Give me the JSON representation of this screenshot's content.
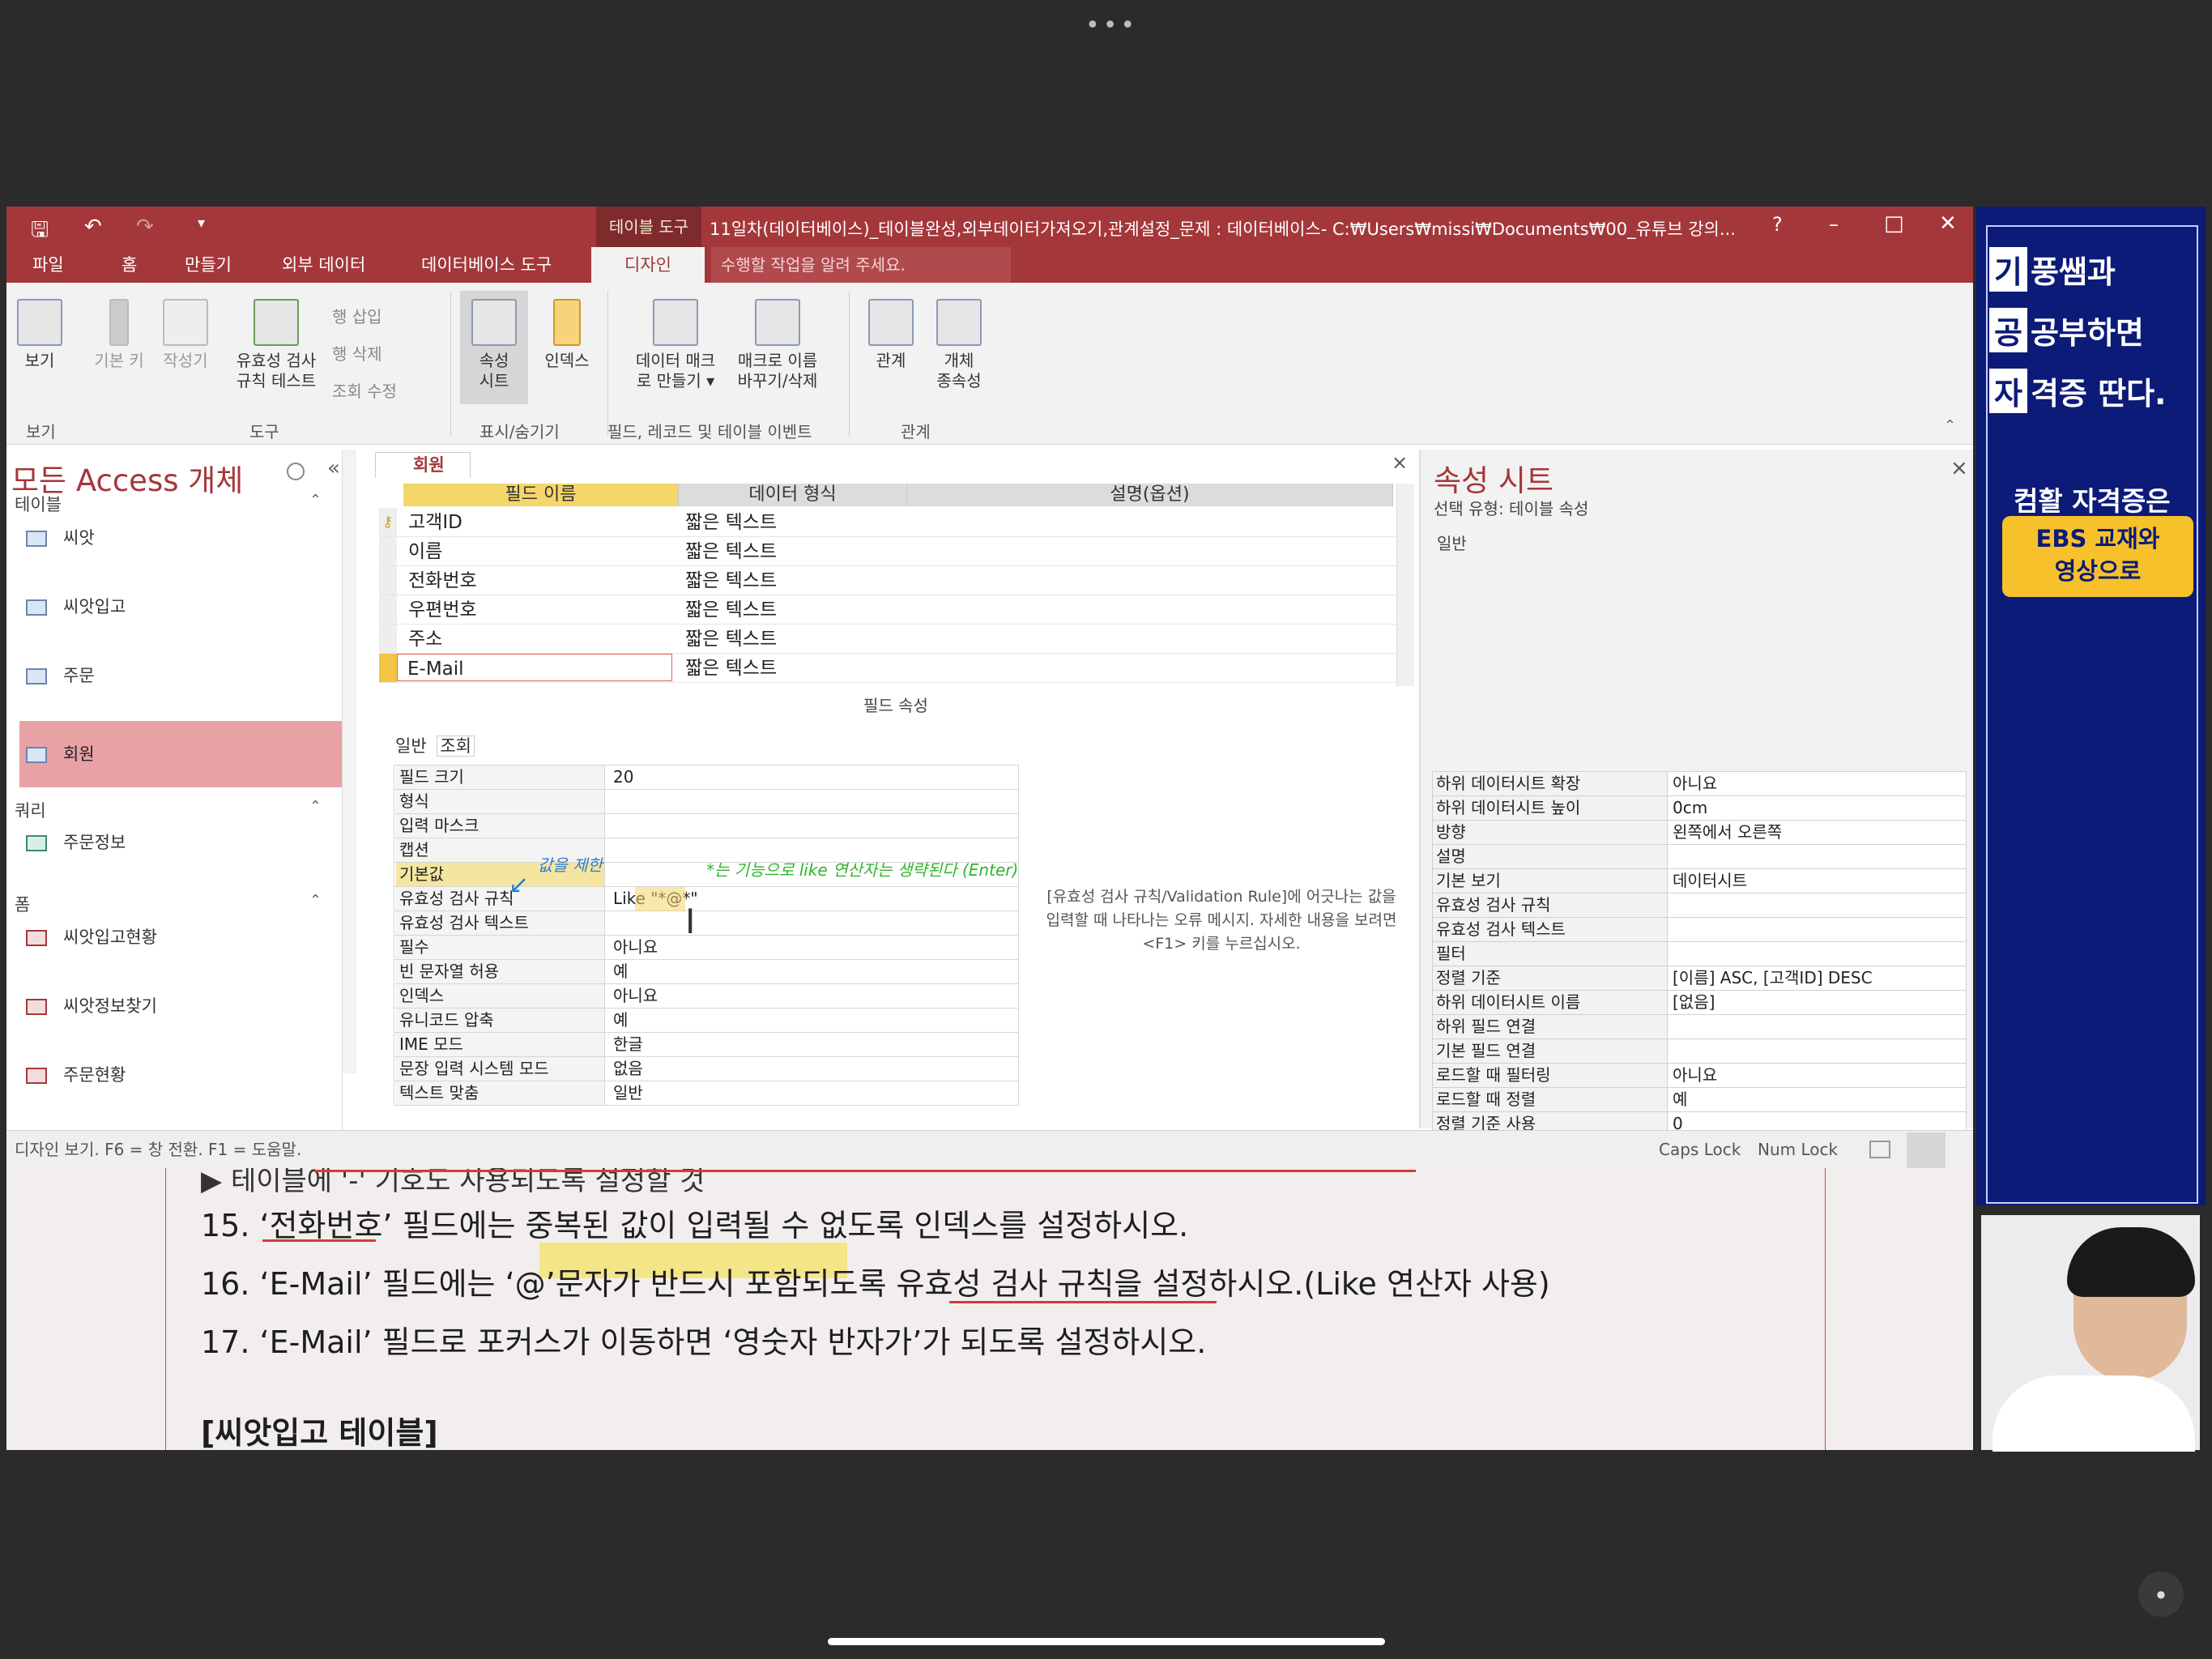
{
  "window": {
    "tool_tab": "테이블 도구",
    "title": "11일차(데이터베이스)_테이블완성,외부데이터가져오기,관계설정_문제 : 데이터베이스- C:₩Users₩missi₩Documents₩00_유튜브 강의...",
    "help": "?",
    "minimize": "–",
    "maximize": "□",
    "close": "✕"
  },
  "menu": [
    "파일",
    "홈",
    "만들기",
    "외부 데이터",
    "데이터베이스 도구"
  ],
  "menu_active": "디자인",
  "tellme": "수행할 작업을 알려 주세요.",
  "ribbon": {
    "view": "보기",
    "primary_key": "기본 키",
    "builder": "작성기",
    "validation1": "유효성 검사",
    "validation2": "규칙 테스트",
    "insert_row": "행 삽입",
    "delete_row": "행 삭제",
    "modify_lookup": "조회 수정",
    "prop_sheet1": "속성",
    "prop_sheet2": "시트",
    "index": "인덱스",
    "data_macro1": "데이터 매크",
    "data_macro2": "로 만들기 ▾",
    "rename_macro1": "매크로 이름",
    "rename_macro2": "바꾸기/삭제",
    "relations": "관계",
    "deps1": "개체",
    "deps2": "종속성",
    "groups": [
      "보기",
      "도구",
      "표시/숨기기",
      "필드, 레코드 및 테이블 이벤트",
      "관계"
    ]
  },
  "nav": {
    "title": "모든 Access 개체",
    "sections": [
      "테이블",
      "쿼리",
      "폼"
    ],
    "tables": [
      "씨앗",
      "씨앗입고",
      "주문",
      "회원"
    ],
    "queries": [
      "주문정보"
    ],
    "forms": [
      "씨앗입고현황",
      "씨앗정보찾기",
      "주문현황"
    ]
  },
  "doc_tab": "회원",
  "grid": {
    "headers": [
      "필드 이름",
      "데이터 형식",
      "설명(옵션)"
    ],
    "rows": [
      {
        "name": "고객ID",
        "type": "짧은 텍스트"
      },
      {
        "name": "이름",
        "type": "짧은 텍스트"
      },
      {
        "name": "전화번호",
        "type": "짧은 텍스트"
      },
      {
        "name": "우편번호",
        "type": "짧은 텍스트"
      },
      {
        "name": "주소",
        "type": "짧은 텍스트"
      },
      {
        "name": "E-Mail",
        "type": "짧은 텍스트"
      }
    ]
  },
  "field_props": {
    "title": "필드 속성",
    "tabs": [
      "일반",
      "조회"
    ],
    "rows": [
      {
        "label": "필드 크기",
        "value": "20"
      },
      {
        "label": "형식",
        "value": ""
      },
      {
        "label": "입력 마스크",
        "value": ""
      },
      {
        "label": "캡션",
        "value": ""
      },
      {
        "label": "기본값",
        "value": ""
      },
      {
        "label": "유효성 검사 규칙",
        "value": "Like \"*@*\""
      },
      {
        "label": "유효성 검사 텍스트",
        "value": ""
      },
      {
        "label": "필수",
        "value": "아니요"
      },
      {
        "label": "빈 문자열 허용",
        "value": "예"
      },
      {
        "label": "인덱스",
        "value": "아니요"
      },
      {
        "label": "유니코드 압축",
        "value": "예"
      },
      {
        "label": "IME 모드",
        "value": "한글"
      },
      {
        "label": "문장 입력 시스템 모드",
        "value": "없음"
      },
      {
        "label": "텍스트 맞춤",
        "value": "일반"
      }
    ],
    "help": "[유효성 검사 규칙/Validation Rule]에 어긋나는 값을 입력할 때 나타나는 오류 메시지. 자세한 내용을 보려면 <F1> 키를 누르십시오.",
    "annotation1": "값을 제한",
    "annotation2": "*는 기능으로 like 연산자는 생략된다 (Enter)"
  },
  "prop_sheet": {
    "title": "속성 시트",
    "subtitle": "선택 유형: 테이블 속성",
    "tab": "일반",
    "rows": [
      {
        "label": "하위 데이터시트 확장",
        "value": "아니요"
      },
      {
        "label": "하위 데이터시트 높이",
        "value": "0cm"
      },
      {
        "label": "방향",
        "value": "왼쪽에서 오른쪽"
      },
      {
        "label": "설명",
        "value": ""
      },
      {
        "label": "기본 보기",
        "value": "데이터시트"
      },
      {
        "label": "유효성 검사 규칙",
        "value": ""
      },
      {
        "label": "유효성 검사 텍스트",
        "value": ""
      },
      {
        "label": "필터",
        "value": ""
      },
      {
        "label": "정렬 기준",
        "value": "[이름] ASC, [고객ID] DESC"
      },
      {
        "label": "하위 데이터시트 이름",
        "value": "[없음]"
      },
      {
        "label": "하위 필드 연결",
        "value": ""
      },
      {
        "label": "기본 필드 연결",
        "value": ""
      },
      {
        "label": "로드할 때 필터링",
        "value": "아니요"
      },
      {
        "label": "로드할 때 정렬",
        "value": "예"
      },
      {
        "label": "정렬 기준 사용",
        "value": "0"
      }
    ]
  },
  "status": {
    "left": "디자인 보기.  F6 = 창 전환.  F1 = 도움말.",
    "caps": "Caps Lock",
    "num": "Num Lock"
  },
  "worksheet": {
    "line0": "▶  테이블에 '-' 기호도 사용되도록 설정할 것",
    "line15": "15. ‘전화번호’ 필드에는 중복된 값이 입력될 수 없도록 인덱스를 설정하시오.",
    "line16": "16. ‘E-Mail’ 필드에는 ‘@’문자가 반드시 포함되도록 유효성 검사 규칙을 설정하시오.(Like 연산자 사용)",
    "line17": "17. ‘E-Mail’ 필드로 포커스가 이동하면 ‘영숫자 반자가’가 되도록 설정하시오.",
    "heading": "[씨앗입고 테이블]"
  },
  "promo": {
    "l1box": "기",
    "l1": "풍쌤과",
    "l2box": "공",
    "l2": "공부하면",
    "l3box": "자",
    "l3": "격증 딴다.",
    "q": "컴활 자격증은",
    "badge1": "EBS 교재와",
    "badge2": "영상으로"
  },
  "colors": {
    "accent": "#a4373a",
    "promo_bg": "#0c1a78",
    "badge": "#f6c12b"
  }
}
